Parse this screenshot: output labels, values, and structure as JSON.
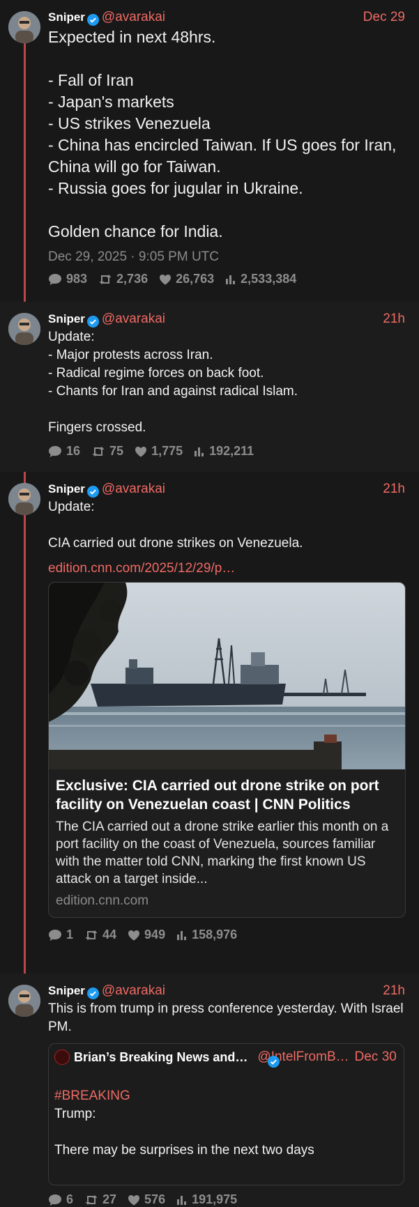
{
  "colors": {
    "background": "#181818",
    "accent": "#f06a64",
    "thread_line": "#b9474b",
    "verified": "#1d9bf0",
    "muted": "#8d8d8d"
  },
  "tweets": [
    {
      "name": "Sniper",
      "handle": "@avarakai",
      "time": "Dec 29",
      "text": "Expected in next 48hrs.\n\n- Fall of Iran\n- Japan's markets\n- US strikes Venezuela\n- China has encircled Taiwan. If US goes for Iran, China will go for Taiwan.\n- Russia goes for jugular in Ukraine.\n\nGolden chance for India.",
      "stamp": "Dec 29, 2025 · 9:05 PM UTC",
      "replies": "983",
      "retweets": "2,736",
      "likes": "26,763",
      "views": "2,533,384"
    },
    {
      "name": "Sniper",
      "handle": "@avarakai",
      "time": "21h",
      "text": "Update:\n- Major protests across Iran.\n- Radical regime forces on back foot.\n- Chants for Iran and against radical Islam.\n\nFingers crossed.",
      "replies": "16",
      "retweets": "75",
      "likes": "1,775",
      "views": "192,211"
    },
    {
      "name": "Sniper",
      "handle": "@avarakai",
      "time": "21h",
      "text": "Update:\n\nCIA carried out drone strikes on Venezuela.",
      "link": "edition.cnn.com/2025/12/29/p…",
      "card": {
        "title": "Exclusive: CIA carried out drone strike on port facility on Venezuelan coast | CNN Politics",
        "description": "The CIA carried out a drone strike earlier this month on a port facility on the coast of Venezuela, sources familiar with the matter told CNN, marking the first known US attack on a target inside...",
        "domain": "edition.cnn.com"
      },
      "replies": "1",
      "retweets": "44",
      "likes": "949",
      "views": "158,976"
    },
    {
      "name": "Sniper",
      "handle": "@avarakai",
      "time": "21h",
      "text": "This is from trump in press conference yesterday. With Israel PM.",
      "quote": {
        "name": "Brian’s Breaking News and…",
        "handle": "@IntelFromB…",
        "time": "Dec 30",
        "hashtag": "#BREAKING",
        "text": "Trump:\n\nThere may be surprises in the next two days"
      },
      "replies": "6",
      "retweets": "27",
      "likes": "576",
      "views": "191,975"
    }
  ]
}
